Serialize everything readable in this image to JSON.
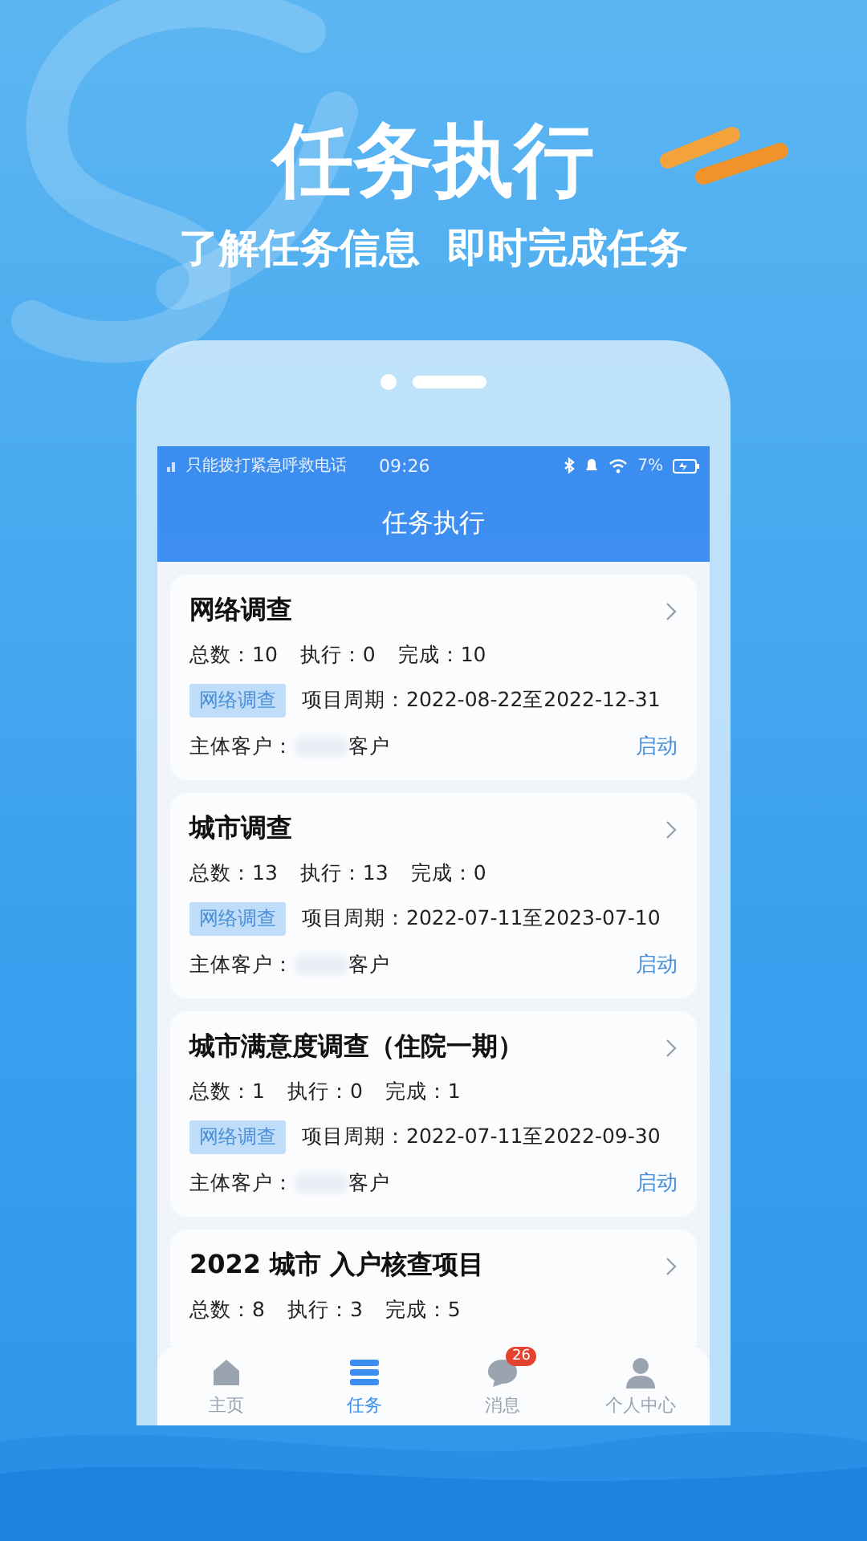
{
  "hero": {
    "title": "任务执行",
    "subtitle": "了解任务信息  即时完成任务"
  },
  "status_bar": {
    "carrier": "只能拨打紧急呼救电话",
    "time": "09:26",
    "battery": "7%"
  },
  "header": {
    "title": "任务执行"
  },
  "tasks": [
    {
      "title": "网络调查",
      "stats": [
        "总数：10",
        "执行：0",
        "完成：10"
      ],
      "tag": "网络调查",
      "period": "项目周期：2022-08-22至2022-12-31",
      "client_label": "主体客户：",
      "client": "客户",
      "action": "启动"
    },
    {
      "title": "城市调查",
      "stats": [
        "总数：13",
        "执行：13",
        "完成：0"
      ],
      "tag": "网络调查",
      "period": "项目周期：2022-07-11至2023-07-10",
      "client_label": "主体客户：",
      "client": "客户",
      "action": "启动"
    },
    {
      "title": "城市满意度调查（住院一期）",
      "stats": [
        "总数：1",
        "执行：0",
        "完成：1"
      ],
      "tag": "网络调查",
      "period": "项目周期：2022-07-11至2022-09-30",
      "client_label": "主体客户：",
      "client": "客户",
      "action": "启动"
    },
    {
      "title": "2022 城市 入户核查项目",
      "stats": [
        "总数：8",
        "执行：3",
        "完成：5"
      ]
    }
  ],
  "tab_bar": [
    {
      "label": "主页",
      "kind": "home",
      "selected": false
    },
    {
      "label": "任务",
      "kind": "list",
      "selected": true
    },
    {
      "label": "消息",
      "kind": "chat",
      "selected": false,
      "badge": "26"
    },
    {
      "label": "个人中心",
      "kind": "person",
      "selected": false
    }
  ]
}
